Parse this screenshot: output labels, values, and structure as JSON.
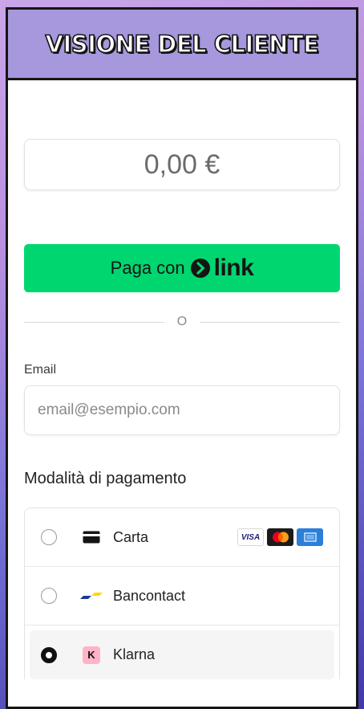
{
  "banner": {
    "title": "VISIONE DEL CLIENTE"
  },
  "checkout": {
    "amount": "0,00 €",
    "link_button": {
      "prefix": "Paga con",
      "brand": "link"
    },
    "divider": "O",
    "email": {
      "label": "Email",
      "placeholder": "email@esempio.com",
      "value": ""
    },
    "payment_title": "Modalità di pagamento",
    "methods": [
      {
        "label": "Carta",
        "icon": "card-icon",
        "selected": false,
        "brands": [
          "visa-logo",
          "mastercard-logo",
          "amex-logo"
        ]
      },
      {
        "label": "Bancontact",
        "icon": "bancontact-icon",
        "selected": false
      },
      {
        "label": "Klarna",
        "icon": "klarna-icon",
        "badge": "K",
        "selected": true
      }
    ]
  },
  "colors": {
    "link_green": "#00d66f",
    "banner_bg": "#a797dc",
    "visa_text": "VISA"
  }
}
